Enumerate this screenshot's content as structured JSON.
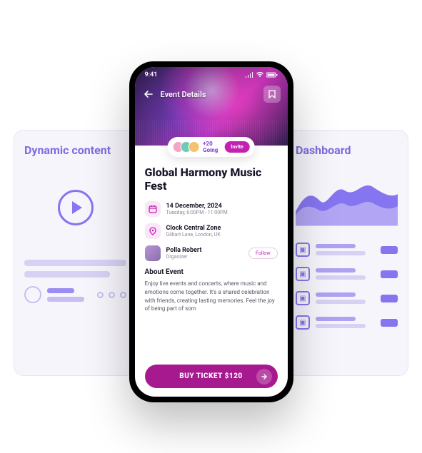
{
  "left_card": {
    "title": "Dynamic content"
  },
  "right_card": {
    "title": "Dashboard"
  },
  "phone": {
    "time": "9:41",
    "header_title": "Event Details",
    "going_count": "+20 Going",
    "invite_label": "Invite",
    "event_title": "Global Harmony Music Fest",
    "date": {
      "primary": "14 December, 2024",
      "secondary": "Tuesday, 6:00PM - 11:00PM"
    },
    "location": {
      "primary": "Clock Central Zone",
      "secondary": "Gilbart Lane, London, UK"
    },
    "organizer": {
      "name": "Polla Robert",
      "role": "Organizer",
      "follow_label": "Follow"
    },
    "about_title": "About Event",
    "about_text": "Enjoy live events and concerts, where music and emotions come together. It's a shared celebration with friends, creating lasting memories. Feel the joy of being part of som",
    "buy_label": "BUY TICKET $120"
  }
}
